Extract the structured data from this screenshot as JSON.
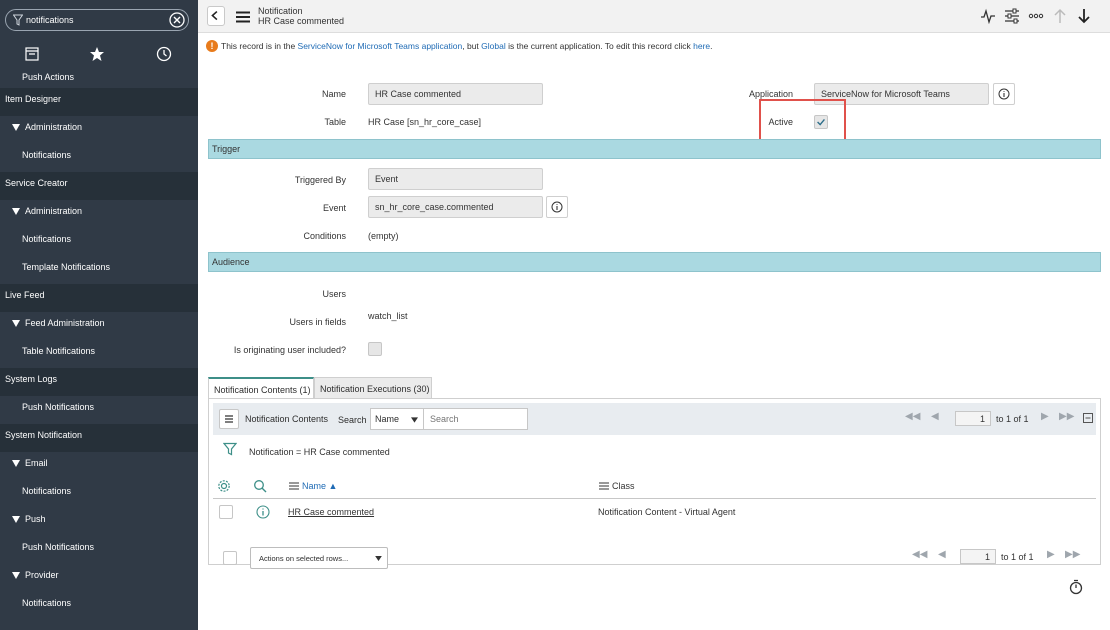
{
  "sidebar": {
    "filter_value": "notifications",
    "items": [
      {
        "label": "Push Actions",
        "kind": "module"
      },
      {
        "label": "Item Designer",
        "kind": "app"
      },
      {
        "label": "Administration",
        "kind": "sub"
      },
      {
        "label": "Notifications",
        "kind": "module"
      },
      {
        "label": "Service Creator",
        "kind": "app"
      },
      {
        "label": "Administration",
        "kind": "sub"
      },
      {
        "label": "Notifications",
        "kind": "module"
      },
      {
        "label": "Template Notifications",
        "kind": "module"
      },
      {
        "label": "Live Feed",
        "kind": "app"
      },
      {
        "label": "Feed Administration",
        "kind": "sub"
      },
      {
        "label": "Table Notifications",
        "kind": "module"
      },
      {
        "label": "System Logs",
        "kind": "app"
      },
      {
        "label": "Push Notifications",
        "kind": "module"
      },
      {
        "label": "System Notification",
        "kind": "app"
      },
      {
        "label": "Email",
        "kind": "sub"
      },
      {
        "label": "Notifications",
        "kind": "module"
      },
      {
        "label": "Push",
        "kind": "sub"
      },
      {
        "label": "Push Notifications",
        "kind": "module"
      },
      {
        "label": "Provider",
        "kind": "sub"
      },
      {
        "label": "Notifications",
        "kind": "module"
      }
    ]
  },
  "header": {
    "title_line1": "Notification",
    "title_line2": "HR Case commented"
  },
  "banner": {
    "text_prefix": "This record is in the ",
    "app_link": "ServiceNow for Microsoft Teams application",
    "text_mid": ", but ",
    "global_link": "Global",
    "text_mid2": " is the current application. To edit this record click ",
    "here_link": "here",
    "text_suffix": "."
  },
  "form": {
    "name_label": "Name",
    "name_value": "HR Case commented",
    "table_label": "Table",
    "table_value": "HR Case [sn_hr_core_case]",
    "application_label": "Application",
    "application_value": "ServiceNow for Microsoft Teams",
    "active_label": "Active",
    "active_checked": true,
    "trigger_section": "Trigger",
    "triggered_by_label": "Triggered By",
    "triggered_by_value": "Event",
    "event_label": "Event",
    "event_value": "sn_hr_core_case.commented",
    "conditions_label": "Conditions",
    "conditions_value": "(empty)",
    "audience_section": "Audience",
    "users_label": "Users",
    "users_in_fields_label": "Users in fields",
    "users_in_fields_value": "watch_list",
    "originating_label": "Is originating user included?"
  },
  "related": {
    "tabs": [
      "Notification Contents (1)",
      "Notification Executions (30)"
    ],
    "toolbar_title": "Notification Contents",
    "search_label": "Search",
    "search_field": "Name",
    "search_placeholder": "Search",
    "page_value": "1",
    "page_of": "to 1 of 1",
    "filter_text": "Notification = HR Case commented",
    "col_name": "Name ▲",
    "col_class": "Class",
    "row_name": "HR Case commented",
    "row_class": "Notification Content - Virtual Agent",
    "actions_label": "Actions on selected rows..."
  },
  "colors": {
    "sidebar_bg": "#303a46",
    "section_bar": "#aad9e1",
    "link": "#1f6bb5",
    "warning": "#e87b1c",
    "highlight": "#e0514b"
  }
}
